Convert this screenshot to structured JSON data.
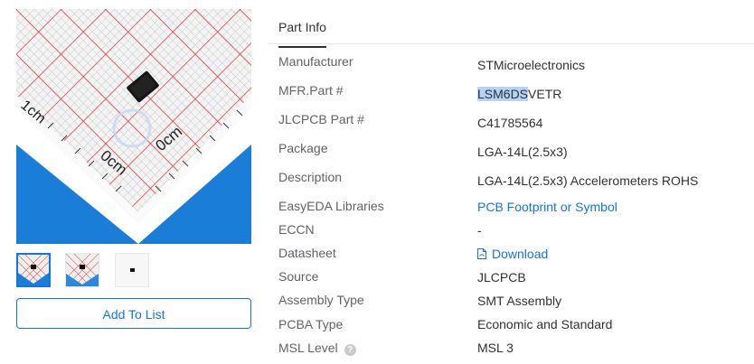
{
  "gallery": {
    "main_image_alt": "LSM6DSVETR chip on cm scale",
    "ruler_labels": [
      "1cm",
      "0cm",
      "0cm"
    ],
    "thumbnail_count": 3,
    "add_to_list_label": "Add To List"
  },
  "tabs": [
    {
      "label": "Part Info",
      "active": true
    }
  ],
  "part_info": {
    "manufacturer": {
      "label": "Manufacturer",
      "value": "STMicroelectronics"
    },
    "mfr_part": {
      "label": "MFR.Part #",
      "value_highlighted": "LSM6DS",
      "value_rest": "VETR"
    },
    "jlcpcb_part": {
      "label": "JLCPCB Part #",
      "value": "C41785564"
    },
    "package": {
      "label": "Package",
      "value": "LGA-14L(2.5x3)"
    },
    "description": {
      "label": "Description",
      "value": "LGA-14L(2.5x3) Accelerometers ROHS"
    },
    "easyeda": {
      "label": "EasyEDA Libraries",
      "value": "PCB Footprint or Symbol"
    },
    "eccn": {
      "label": "ECCN",
      "value": "-"
    },
    "datasheet": {
      "label": "Datasheet",
      "value": "Download",
      "icon": "pdf-icon"
    },
    "source": {
      "label": "Source",
      "value": "JLCPCB"
    },
    "assembly_type": {
      "label": "Assembly Type",
      "value": "SMT Assembly"
    },
    "pcba_type": {
      "label": "PCBA Type",
      "value": "Economic and Standard"
    },
    "msl_level": {
      "label": "MSL Level",
      "value": "MSL 3",
      "icon": "help-icon"
    }
  },
  "colors": {
    "accent": "#1473e6",
    "grid_red": "#e0303a",
    "ruler_blue": "#1a7ed8",
    "selection": "#b4d3f5"
  }
}
